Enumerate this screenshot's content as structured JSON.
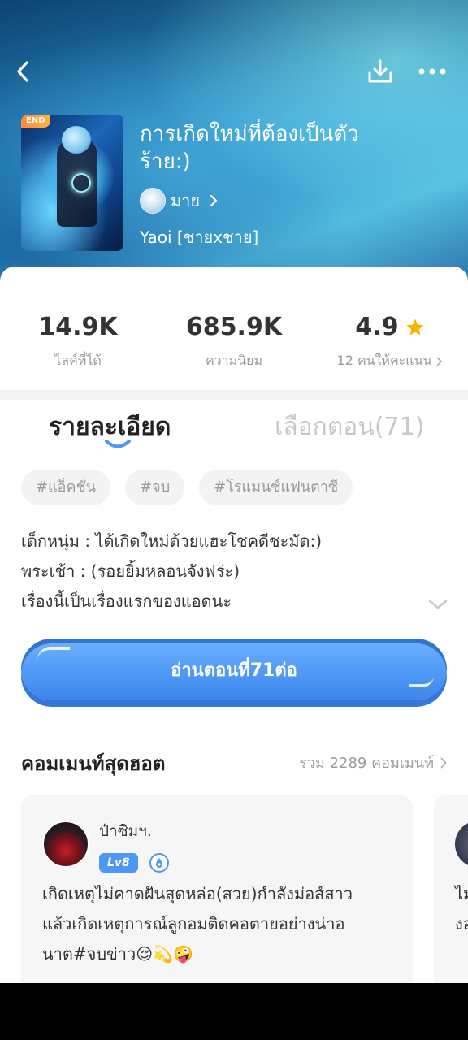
{
  "header": {
    "end_badge": "END",
    "title_line1": "การเกิดใหม่ที่ต้องเป็นตัว",
    "title_line2": "ร้าย:)",
    "author": "มาย",
    "genre": "Yaoi [ชายxชาย]"
  },
  "stats": [
    {
      "value": "14.9K",
      "label": "ไลค์ที่ได้"
    },
    {
      "value": "685.9K",
      "label": "ความนิยม"
    },
    {
      "value": "4.9",
      "label": "12 คนให้คะแนน"
    }
  ],
  "tabs": {
    "detail": "รายละเอียด",
    "episodes": "เลือกตอน(71)"
  },
  "tags": [
    "#แอ็คชั่น",
    "#จบ",
    "#โรแมนซ์แฟนตาซี"
  ],
  "description": [
    "เด็กหนุ่ม : ได้เกิดใหม่ด้วยแฮะโชคดีชะมัด:)",
    "พระเช้า : (รอยยิ้มหลอนจังฟร่ะ)",
    "เรื่องนี้เป็นเรื่องแรกของแอดนะ"
  ],
  "read_button": "อ่านตอนที่71ต่อ",
  "comments": {
    "title": "คอมเมนท์สุดฮอต",
    "total": "รวม 2289 คอมเมนท์",
    "items": [
      {
        "name": "ป๋าซิมฯ.",
        "level": "Lv8",
        "lines": [
          "เกิดเหตุไม่คาดฝันสุดหล่อ(สวย)กำลังม่อส์สาว",
          "แล้วเกิดเหตุการณ์ลูกอมติดคอตายอย่างน่าอ",
          "นาต#จบข่าว😌💫🤪"
        ]
      }
    ],
    "peek_lines": [
      "ไม",
      "งอ"
    ]
  },
  "colors": {
    "accent": "#4d98f5",
    "star": "#f5b400",
    "muted": "#9a9a9a"
  },
  "icons": [
    "back-icon",
    "download-icon",
    "more-icon",
    "chevron-right-icon",
    "star-icon",
    "chevron-down-icon",
    "level-badge-icon"
  ]
}
